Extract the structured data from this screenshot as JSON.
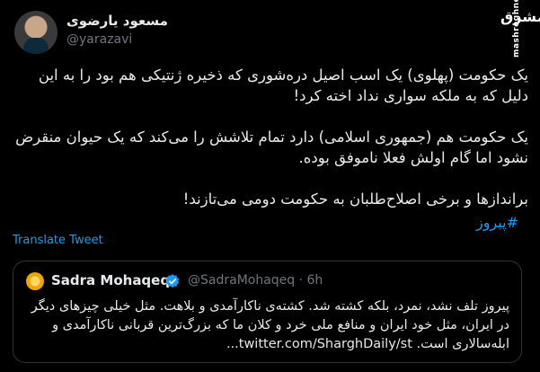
{
  "author": {
    "name": "مسعود یارضوی",
    "handle": "@yarazavi"
  },
  "brand": {
    "logo_text": "مشرق",
    "site_text": "mashreghnews.ir"
  },
  "tweet": {
    "paragraphs": [
      "یک حکومت (پهلوی) یک اسب اصیل دره‌شوری که ذخیره ژنتیکی هم بود را به این دلیل که به ملکه سواری نداد اخته کرد!",
      "یک حکومت هم (جمهوری اسلامی) دارد تمام تلاشش را می‌کند که یک حیوان منقرض نشود اما گام اولش فعلا ناموفق بوده.",
      "براندازها و برخی اصلاح‌طلبان به حکومت دومی می‌تازند!"
    ],
    "hashtag": "#پیروز",
    "translate_label": "Translate Tweet"
  },
  "quoted": {
    "name": "Sadra Mohaqeq",
    "handle_time": "@SadraMohaqeq · 6h",
    "text": "پیروز تلف نشد، نمرد، بلکه کشته شد. کشته‌ی ناکارآمدی و بلاهت. مثل خیلی چیزهای دیگر در ایران، مثل خود ایران و منافع ملی خرد و کلان ما که بزرگ‌ترین قربانی ناکارآمدی و ابله‌سالاری است. twitter.com/SharghDaily/st..."
  },
  "colors": {
    "background": "#000000",
    "link": "#1d9bf0",
    "muted": "#71767b",
    "border": "#2f3336"
  }
}
